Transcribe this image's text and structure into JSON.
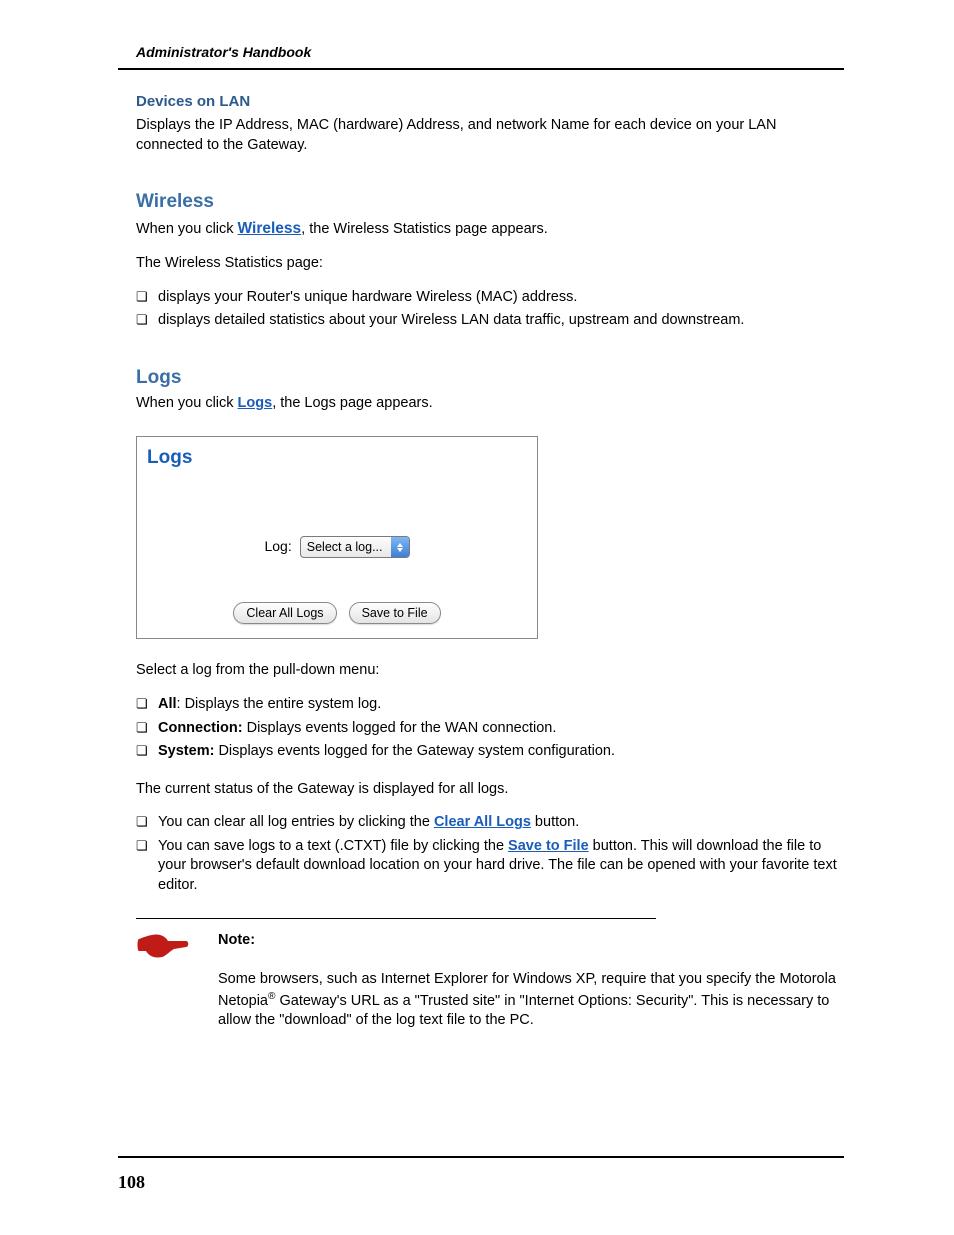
{
  "header": {
    "title": "Administrator's Handbook"
  },
  "section1": {
    "heading": "Devices on LAN",
    "body": "Displays the IP Address, MAC (hardware) Address, and network Name for each device on your LAN connected to the Gateway."
  },
  "wireless": {
    "heading": "Wireless",
    "intro_prefix": "When you click ",
    "intro_link": "Wireless",
    "intro_suffix": ", the Wireless Statistics page appears.",
    "line2": "The Wireless Statistics page:",
    "bullets": [
      "displays your Router's unique hardware Wireless (MAC) address.",
      "displays detailed statistics about your Wireless LAN data traffic, upstream and downstream."
    ]
  },
  "logs": {
    "heading": "Logs",
    "intro_prefix": "When you click ",
    "intro_link": "Logs",
    "intro_suffix": ", the Logs page appears.",
    "panel": {
      "title": "Logs",
      "label": "Log:",
      "select_value": "Select a log...",
      "btn_clear": "Clear All Logs",
      "btn_save": "Save to File"
    },
    "post_panel": "Select a log from the pull-down menu:",
    "options": [
      {
        "name": "All",
        "desc": ": Displays the entire system log."
      },
      {
        "name": "Connection:",
        "desc": " Displays events logged for the WAN connection."
      },
      {
        "name": "System:",
        "desc": " Displays events logged for the Gateway system configuration."
      }
    ],
    "status_line": "The current status of the Gateway is displayed for all logs.",
    "actions": {
      "clear_prefix": "You can clear all log entries by clicking the ",
      "clear_link": "Clear All Logs",
      "clear_suffix": " button.",
      "save_prefix": "You can save logs to a text (.CTXT) file by clicking the ",
      "save_link": "Save to File",
      "save_suffix": " button. This will download the file to your browser's default download location on your hard drive. The file can be opened with your favorite text editor."
    }
  },
  "note": {
    "label": "Note:",
    "body_prefix": "Some browsers, such as Internet Explorer for Windows XP, require that you specify the Motorola Netopia",
    "reg": "®",
    "body_suffix": " Gateway's URL as a \"Trusted site\" in \"Internet Options: Security\". This is necessary to allow the \"download\" of the log text file to the PC."
  },
  "footer": {
    "page_number": "108"
  }
}
